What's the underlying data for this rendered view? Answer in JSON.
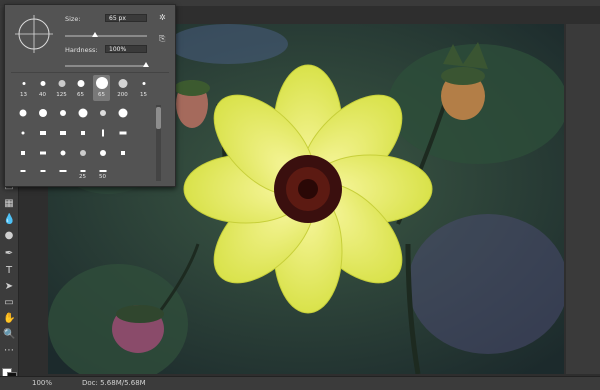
{
  "brush_panel": {
    "size_label": "Size:",
    "size_value": "65 px",
    "hardness_label": "Hardness:",
    "hardness_value": "100%",
    "presets": [
      {
        "label": "13"
      },
      {
        "label": "40"
      },
      {
        "label": "125"
      },
      {
        "label": "65"
      },
      {
        "label": "65",
        "selected": true
      },
      {
        "label": "200"
      },
      {
        "label": "15"
      }
    ],
    "grid_numbers": [
      "25",
      "50"
    ],
    "gear_icon": "gear-icon",
    "new_preset_icon": "new-preset-icon"
  },
  "status": {
    "zoom": "100%",
    "doc": "Doc: 5.68M/5.68M"
  },
  "colors": {
    "panel_bg": "#535353",
    "flower_petal": "#e9f06a",
    "flower_center": "#3a0f0e"
  }
}
